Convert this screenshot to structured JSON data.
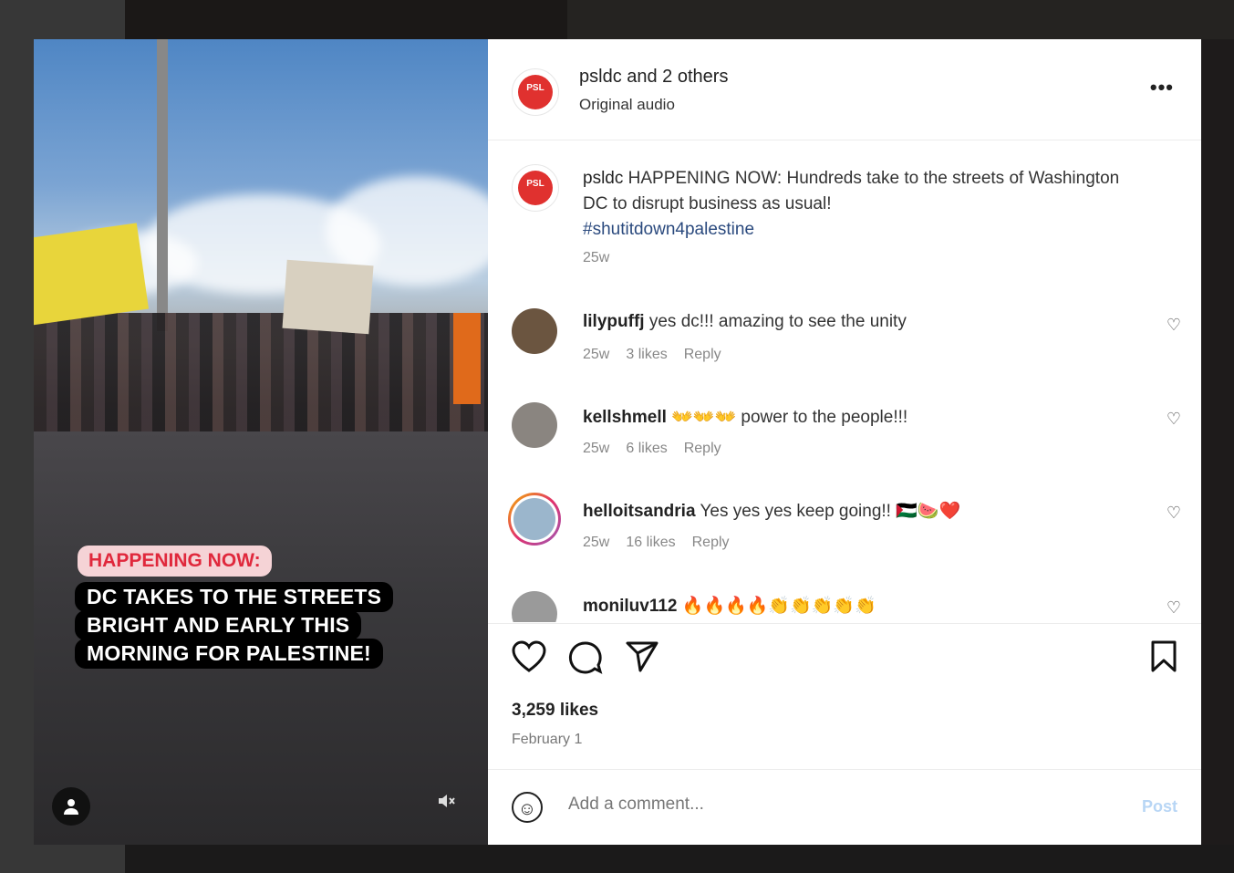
{
  "header": {
    "title": "psldc and 2 others",
    "audio": "Original audio",
    "more_icon": "more-horizontal-icon"
  },
  "media": {
    "tag": "HAPPENING NOW:",
    "caption_lines": [
      "DC TAKES TO THE STREETS",
      "BRIGHT AND EARLY THIS",
      "MORNING FOR PALESTINE!"
    ],
    "mute_icon": "muted-speaker-icon",
    "user_icon": "user-icon"
  },
  "caption": {
    "username": "psldc",
    "text": "HAPPENING NOW: Hundreds take to the streets of Washington DC to disrupt business as usual!",
    "hashtag": "#shutitdown4palestine",
    "time": "25w"
  },
  "comments": [
    {
      "username": "lilypuffj",
      "text": "yes dc!!! amazing to see the unity",
      "time": "25w",
      "likes": "3 likes",
      "reply": "Reply"
    },
    {
      "username": "kellshmell",
      "text": "👐👐👐 power to the people!!!",
      "time": "25w",
      "likes": "6 likes",
      "reply": "Reply"
    },
    {
      "username": "helloitsandria",
      "text": "Yes yes yes keep going!! 🇵🇸🍉❤️",
      "time": "25w",
      "likes": "16 likes",
      "reply": "Reply"
    },
    {
      "username": "moniluv112",
      "text": "🔥🔥🔥🔥👏👏👏👏👏",
      "time": "",
      "likes": "",
      "reply": ""
    }
  ],
  "actions": {
    "likes": "3,259 likes",
    "date": "February 1"
  },
  "add_comment": {
    "placeholder": "Add a comment...",
    "post_label": "Post"
  }
}
